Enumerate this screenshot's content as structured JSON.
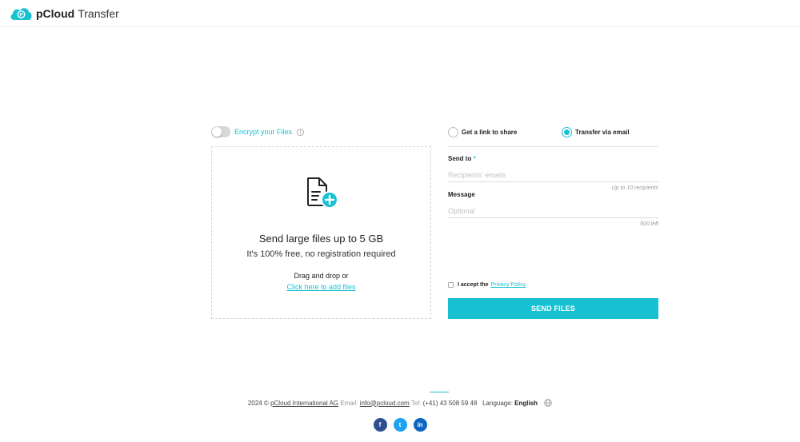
{
  "header": {
    "brand_bold": "pCloud",
    "brand_light": "Transfer"
  },
  "encrypt": {
    "label": "Encrypt your Files",
    "enabled": false,
    "info_glyph": "i"
  },
  "dropzone": {
    "icon": "file-add-icon",
    "title": "Send large files up to 5 GB",
    "subtitle": "It's 100% free, no registration required",
    "drag_text": "Drag and drop or",
    "add_link": "Click here to add files"
  },
  "tabs": [
    {
      "label": "Get a link to share",
      "selected": false
    },
    {
      "label": "Transfer via email",
      "selected": true
    }
  ],
  "form": {
    "send_to_label": "Send to",
    "required_marker": "*",
    "recipients_placeholder": "Recipients' emails",
    "recipients_value": "",
    "recipients_hint": "Up to 10 recipients",
    "message_label": "Message",
    "message_placeholder": "Optional",
    "message_value": "",
    "message_hint": "500 left",
    "accept_text": "I accept the",
    "policy_link": "Privacy Policy",
    "send_button": "SEND FILES"
  },
  "footer": {
    "copyright": "2024 ©",
    "company_link": "pCloud International AG",
    "email_label": "Email:",
    "email_link": "info@pcloud.com",
    "tel_label": "Tel:",
    "tel_value": "(+41) 43 508 59 48",
    "language_label": "Language:",
    "language_value": "English",
    "socials": [
      {
        "glyph": "f",
        "icon": "facebook-icon"
      },
      {
        "glyph": "t",
        "icon": "twitter-icon"
      },
      {
        "glyph": "in",
        "icon": "linkedin-icon"
      }
    ]
  },
  "colors": {
    "accent": "#17c1d2",
    "facebook": "#2e4f8f",
    "twitter": "#1da1f2",
    "linkedin": "#0a66c2"
  }
}
